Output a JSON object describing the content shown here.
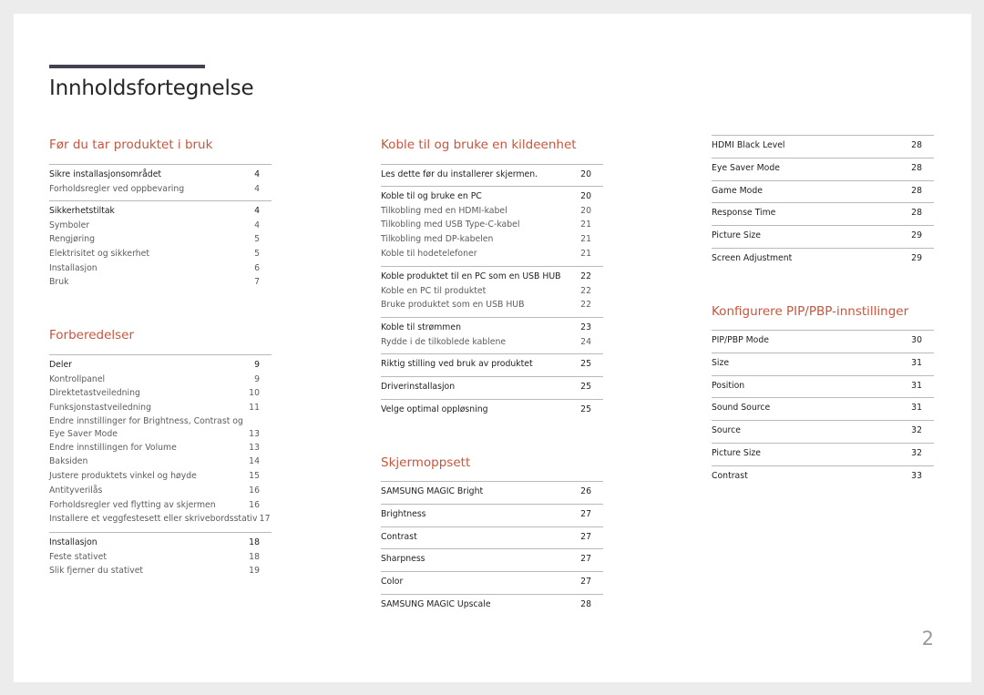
{
  "document": {
    "title": "Innholdsfortegnelse",
    "page_number": "2",
    "colors": {
      "heading_accent": "#c8553d",
      "title_bar": "#45434f",
      "text_main": "#1e1e1e",
      "text_sub": "#5c5c5c"
    }
  },
  "sections": {
    "for_du_tar": {
      "title": "Før du tar produktet i bruk",
      "groups": [
        {
          "items": [
            {
              "label": "Sikre installasjonsområdet",
              "page": "4",
              "main": true
            },
            {
              "label": "Forholdsregler ved oppbevaring",
              "page": "4"
            }
          ]
        },
        {
          "items": [
            {
              "label": "Sikkerhetstiltak",
              "page": "4",
              "main": true
            },
            {
              "label": "Symboler",
              "page": "4"
            },
            {
              "label": "Rengjøring",
              "page": "5"
            },
            {
              "label": "Elektrisitet og sikkerhet",
              "page": "5"
            },
            {
              "label": "Installasjon",
              "page": "6"
            },
            {
              "label": "Bruk",
              "page": "7"
            }
          ]
        }
      ]
    },
    "forberedelser": {
      "title": "Forberedelser",
      "groups": [
        {
          "items": [
            {
              "label": "Deler",
              "page": "9",
              "main": true
            },
            {
              "label": "Kontrollpanel",
              "page": "9"
            },
            {
              "label": "Direktetastveiledning",
              "page": "10"
            },
            {
              "label": "Funksjonstastveiledning",
              "page": "11"
            },
            {
              "label": "Endre innstillinger for Brightness, Contrast og Eye Saver Mode",
              "page": "13"
            },
            {
              "label": "Endre innstillingen for Volume",
              "page": "13"
            },
            {
              "label": "Baksiden",
              "page": "14"
            },
            {
              "label": "Justere produktets vinkel og høyde",
              "page": "15"
            },
            {
              "label": "Antityverilås",
              "page": "16"
            },
            {
              "label": "Forholdsregler ved flytting av skjermen",
              "page": "16"
            },
            {
              "label": "Installere et veggfestesett eller skrivebordsstativ",
              "page": "17"
            }
          ]
        },
        {
          "items": [
            {
              "label": "Installasjon",
              "page": "18",
              "main": true
            },
            {
              "label": "Feste stativet",
              "page": "18"
            },
            {
              "label": "Slik fjerner du stativet",
              "page": "19"
            }
          ]
        }
      ]
    },
    "koble_til": {
      "title": "Koble til og bruke en kildeenhet",
      "groups": [
        {
          "items": [
            {
              "label": "Les dette før du installerer skjermen.",
              "page": "20",
              "main": true
            }
          ]
        },
        {
          "items": [
            {
              "label": "Koble til og bruke en PC",
              "page": "20",
              "main": true
            },
            {
              "label": "Tilkobling med en HDMI-kabel",
              "page": "20"
            },
            {
              "label": "Tilkobling med USB Type-C-kabel",
              "page": "21"
            },
            {
              "label": "Tilkobling med DP-kabelen",
              "page": "21"
            },
            {
              "label": "Koble til hodetelefoner",
              "page": "21"
            }
          ]
        },
        {
          "items": [
            {
              "label": "Koble produktet til en PC som en USB HUB",
              "page": "22",
              "main": true
            },
            {
              "label": "Koble en PC til produktet",
              "page": "22"
            },
            {
              "label": "Bruke produktet som en USB HUB",
              "page": "22"
            }
          ]
        },
        {
          "items": [
            {
              "label": "Koble til strømmen",
              "page": "23",
              "main": true
            },
            {
              "label": "Rydde i de tilkoblede kablene",
              "page": "24"
            }
          ]
        },
        {
          "items": [
            {
              "label": "Riktig stilling ved bruk av produktet",
              "page": "25",
              "main": true
            }
          ]
        },
        {
          "items": [
            {
              "label": "Driverinstallasjon",
              "page": "25",
              "main": true
            }
          ]
        },
        {
          "items": [
            {
              "label": "Velge optimal oppløsning",
              "page": "25",
              "main": true
            }
          ]
        }
      ]
    },
    "skjermoppsett": {
      "title": "Skjermoppsett",
      "items": [
        {
          "label": "SAMSUNG MAGIC Bright",
          "page": "26"
        },
        {
          "label": "Brightness",
          "page": "27"
        },
        {
          "label": "Contrast",
          "page": "27"
        },
        {
          "label": "Sharpness",
          "page": "27"
        },
        {
          "label": "Color",
          "page": "27"
        },
        {
          "label": "SAMSUNG MAGIC Upscale",
          "page": "28"
        },
        {
          "label": "HDMI Black Level",
          "page": "28"
        },
        {
          "label": "Eye Saver Mode",
          "page": "28"
        },
        {
          "label": "Game Mode",
          "page": "28"
        },
        {
          "label": "Response Time",
          "page": "28"
        },
        {
          "label": "Picture Size",
          "page": "29"
        },
        {
          "label": "Screen Adjustment",
          "page": "29"
        }
      ]
    },
    "pip_pbp": {
      "title": "Konfigurere PIP/PBP-innstillinger",
      "items": [
        {
          "label": "PIP/PBP Mode",
          "page": "30"
        },
        {
          "label": "Size",
          "page": "31"
        },
        {
          "label": "Position",
          "page": "31"
        },
        {
          "label": "Sound Source",
          "page": "31"
        },
        {
          "label": "Source",
          "page": "32"
        },
        {
          "label": "Picture Size",
          "page": "32"
        },
        {
          "label": "Contrast",
          "page": "33"
        }
      ]
    }
  }
}
